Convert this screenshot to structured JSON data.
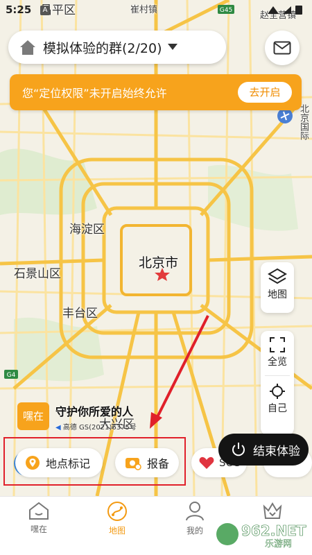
{
  "status_bar": {
    "time": "5:25",
    "notif_badge": "A"
  },
  "map": {
    "labels": {
      "changping": "昌平区",
      "cuicun": "崔村镇",
      "zhaoquanying": "赵全营镇",
      "haidian": "海淀区",
      "shijingshan": "石景山区",
      "beijing": "北京市",
      "fengtai": "丰台区",
      "daxing": "大兴区",
      "airport": "北京国际",
      "g45": "G45",
      "g4": "G4"
    },
    "colors": {
      "land": "#f4f1e6",
      "road_major": "#f6c446",
      "road_minor": "#fbe7a0",
      "green": "#d5e8c4",
      "star": "#e23b3b"
    }
  },
  "header": {
    "group_title": "模拟体验的群(2/20)",
    "home_icon": "home-icon",
    "message_icon": "mail-icon"
  },
  "permission_banner": {
    "text": "您“定位权限”未开启始终允许",
    "button": "去开启",
    "color": "#f7a31c"
  },
  "side_controls": {
    "layers": "地图",
    "overview": "全览",
    "locate": "自己"
  },
  "brand": {
    "logo_text": "嘿在",
    "tagline": "守护你所爱的人",
    "map_credit": "高德 GS(2021)6375号"
  },
  "actions": {
    "location_mark": "地点标记",
    "report": "报备",
    "sos": "SOS",
    "end_trial": "结束体验"
  },
  "tabbar": {
    "tabs": [
      {
        "label": "嘿在",
        "icon": "house-icon"
      },
      {
        "label": "地图",
        "icon": "map-icon"
      },
      {
        "label": "我的",
        "icon": "person-icon"
      },
      {
        "label": "",
        "icon": "crown-icon"
      }
    ],
    "active_color": "#f39a12"
  },
  "watermark": {
    "text": "962.NET",
    "sub": "乐游网"
  }
}
